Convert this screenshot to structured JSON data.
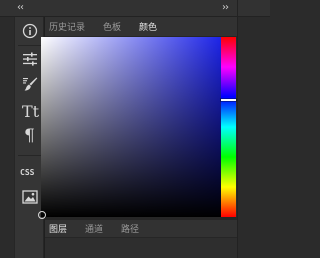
{
  "window": {
    "collapse_glyph": "‹‹",
    "expand_glyph": "››"
  },
  "toolbar": {
    "tools": [
      {
        "name": "info-icon",
        "glyph": "ⓘ"
      },
      {
        "name": "adjustments-icon",
        "glyph": "sliders"
      },
      {
        "name": "brush-icon",
        "glyph": "brush"
      },
      {
        "name": "character-icon",
        "glyph": "Tt"
      },
      {
        "name": "paragraph-icon",
        "glyph": "¶"
      },
      {
        "name": "css-icon",
        "glyph": "CSS"
      },
      {
        "name": "image-icon",
        "glyph": "image"
      }
    ],
    "character_label": "Tt",
    "paragraph_label": "¶",
    "css_label": "CSS"
  },
  "top_tabs": {
    "items": [
      "历史记录",
      "色板",
      "颜色"
    ],
    "active_index": 2
  },
  "color_picker": {
    "base_hue_color": "#1d24e8",
    "hue_position_fraction": 0.34,
    "saturation": 0.0,
    "brightness": 0.0
  },
  "bottom_tabs": {
    "items": [
      "图层",
      "通道",
      "路径"
    ],
    "active_index": 0
  },
  "colors": {
    "panel_bg": "#2b2b2b",
    "header_bg": "#323232",
    "text_active": "#e6e6e6",
    "text_inactive": "#9a9a9a"
  }
}
